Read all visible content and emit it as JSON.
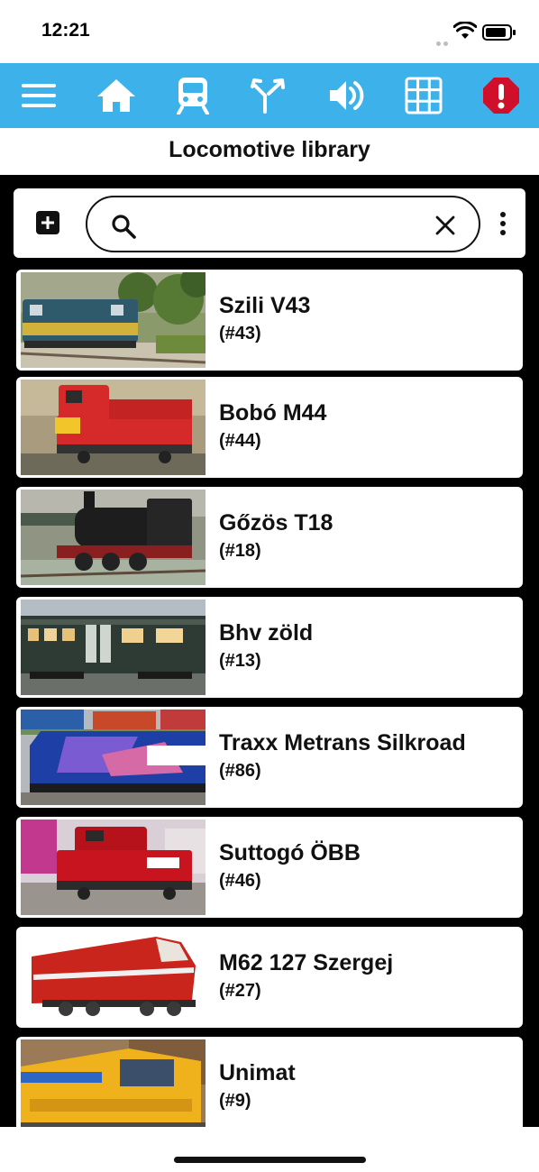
{
  "status_bar": {
    "time": "12:21"
  },
  "toolbar": {
    "buttons": [
      {
        "icon": "menu-icon"
      },
      {
        "icon": "home-icon"
      },
      {
        "icon": "train-icon"
      },
      {
        "icon": "turnout-icon"
      },
      {
        "icon": "speaker-icon"
      },
      {
        "icon": "grid-icon"
      },
      {
        "icon": "emergency-stop-icon"
      }
    ],
    "accent_color": "#3db2ea",
    "emergency_color": "#d0102a"
  },
  "page": {
    "title": "Locomotive library"
  },
  "search": {
    "value": "",
    "placeholder": ""
  },
  "locomotives": [
    {
      "name": "Szili V43",
      "address": "(#43)"
    },
    {
      "name": "Bobó M44",
      "address": "(#44)"
    },
    {
      "name": "Gőzös T18",
      "address": "(#18)"
    },
    {
      "name": "Bhv zöld",
      "address": "(#13)"
    },
    {
      "name": "Traxx Metrans Silkroad",
      "address": "(#86)"
    },
    {
      "name": "Suttogó ÖBB",
      "address": "(#46)"
    },
    {
      "name": "M62 127 Szergej",
      "address": "(#27)"
    },
    {
      "name": "Unimat",
      "address": "(#9)"
    }
  ]
}
